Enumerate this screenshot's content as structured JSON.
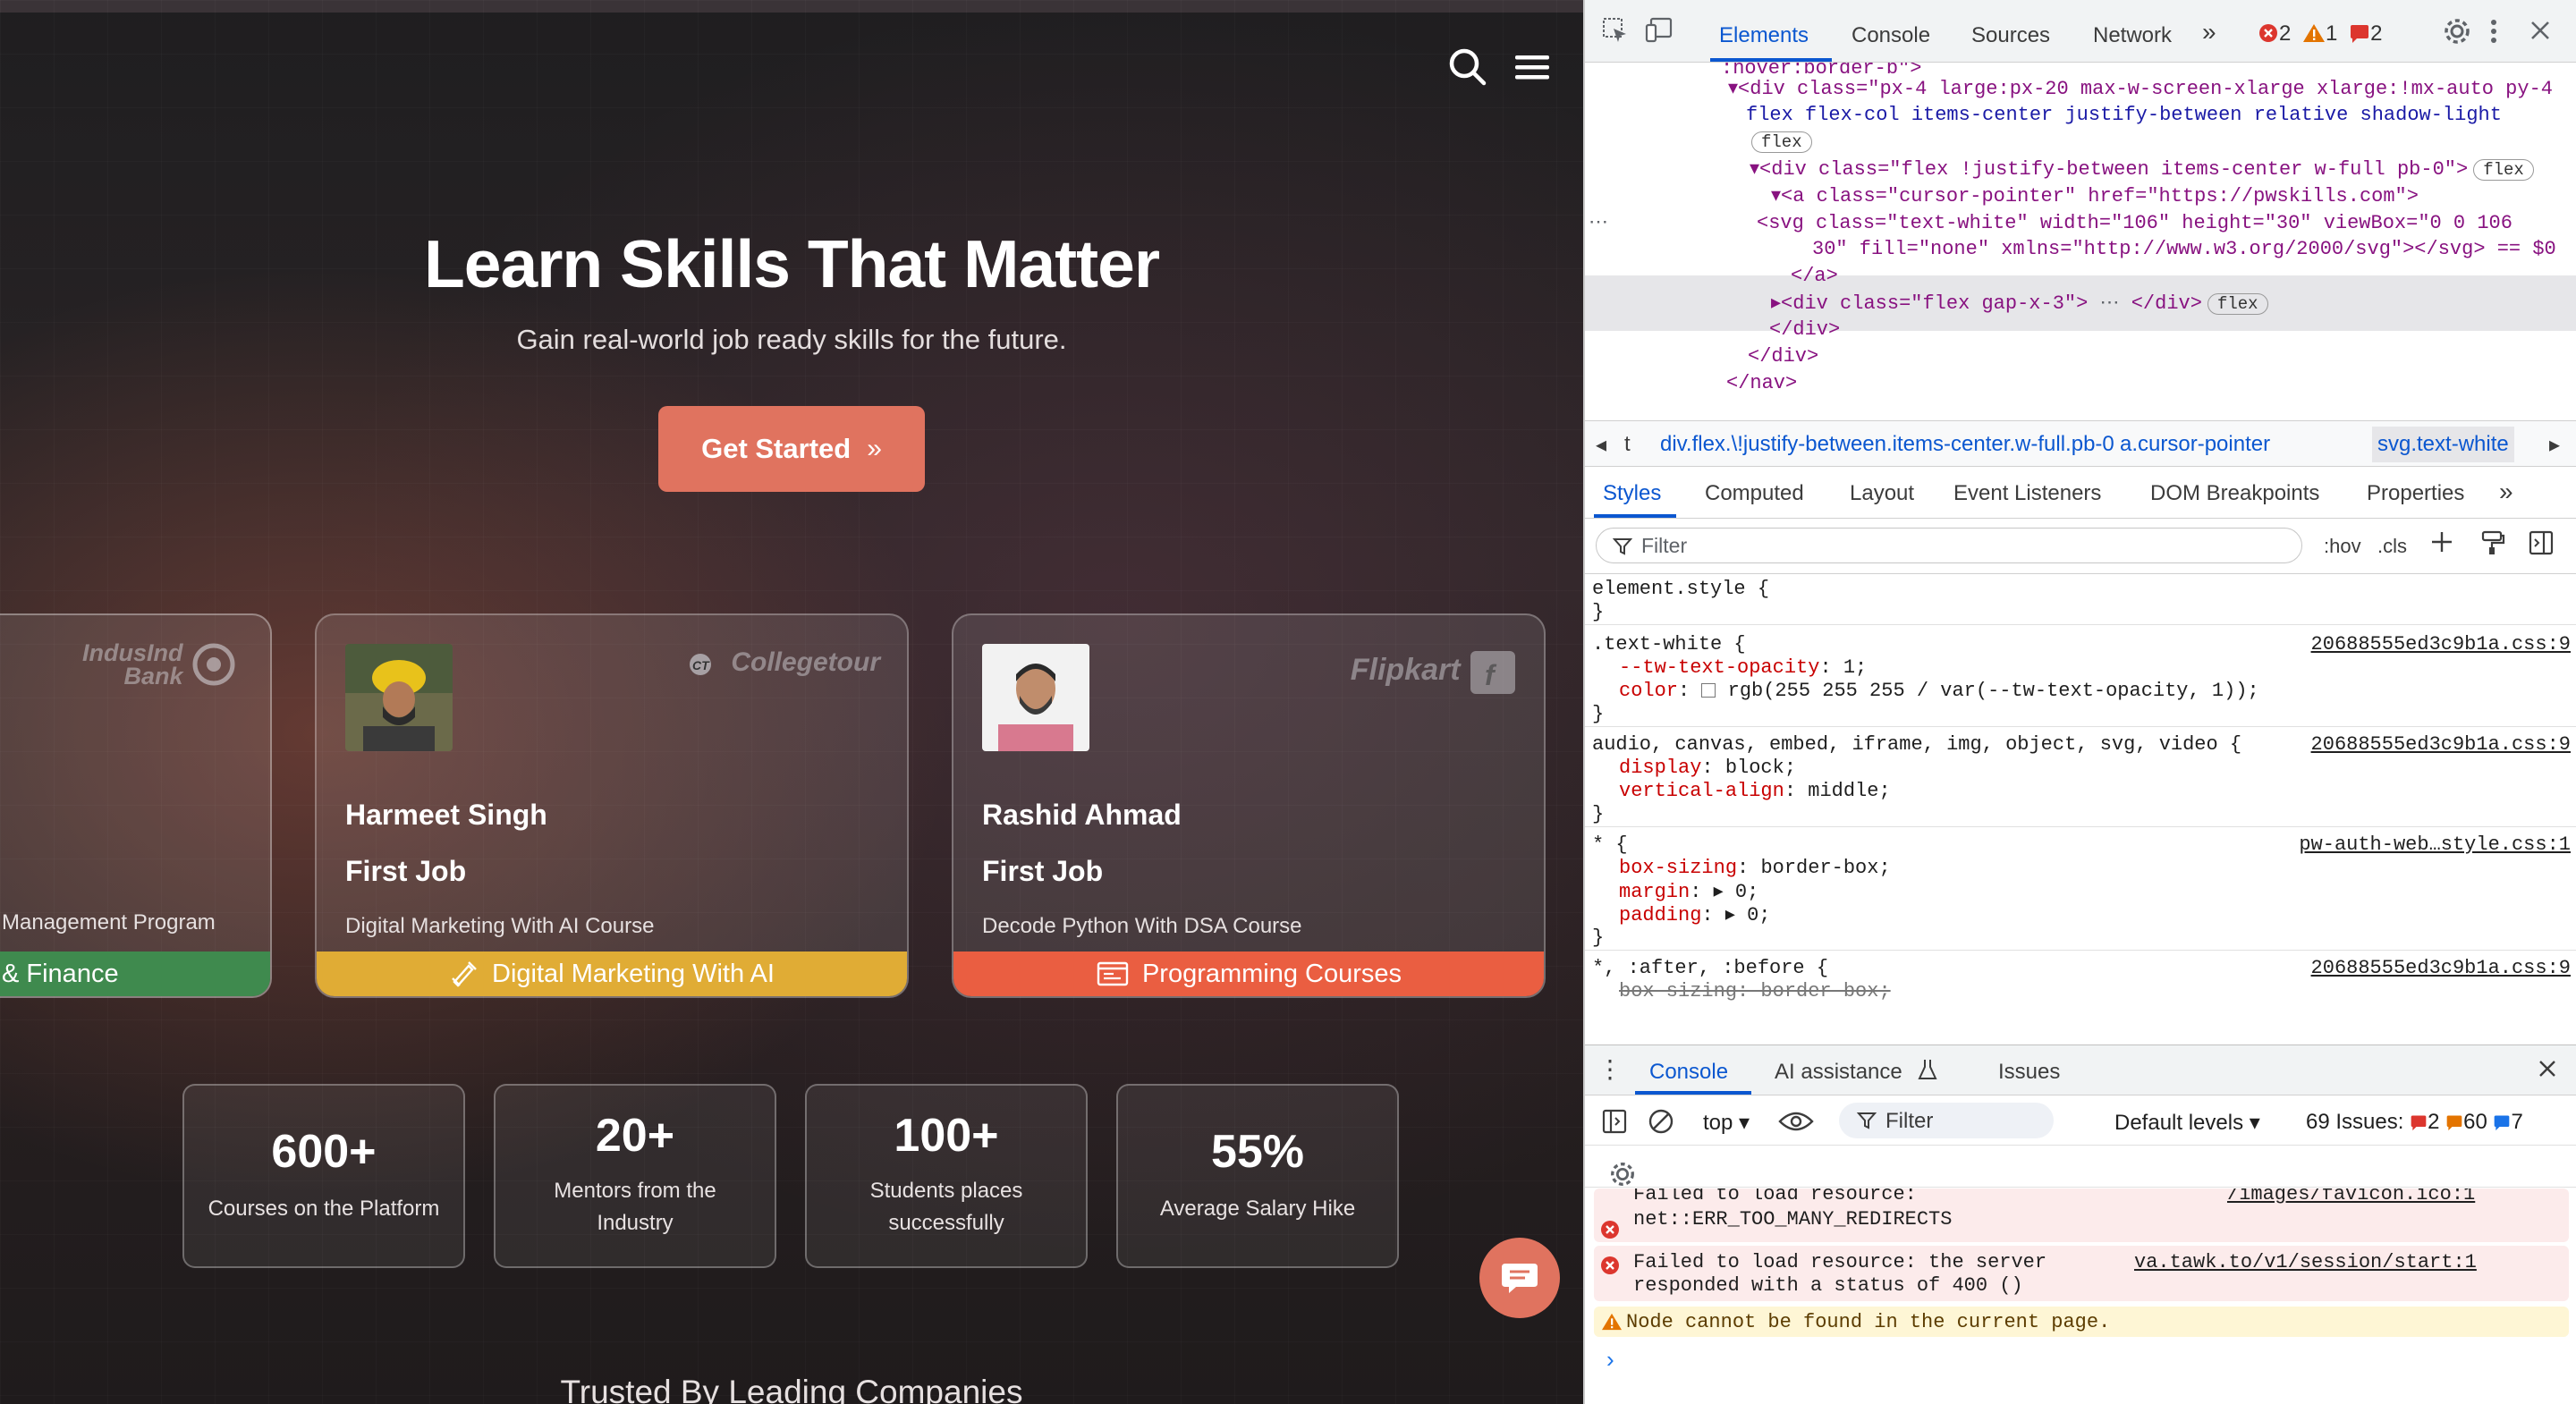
{
  "hero": {
    "title": "Learn Skills That Matter",
    "subtitle": "Gain real-world job ready skills for the future.",
    "cta_label": "Get Started",
    "cta_arrow": "»"
  },
  "cards": [
    {
      "logo": "IndusInd Bank",
      "course": "Management Program",
      "band": "& Finance",
      "band_color": "#3f8a4e"
    },
    {
      "name": "Harmeet Singh",
      "job": "First Job",
      "course": "Digital Marketing With AI Course",
      "band": "Digital Marketing With AI",
      "band_color": "#e0ac35",
      "logo": "Collegetour"
    },
    {
      "name": "Rashid Ahmad",
      "job": "First Job",
      "course": "Decode Python With DSA Course",
      "band": "Programming Courses",
      "band_color": "#ea5e41",
      "logo": "Flipkart"
    }
  ],
  "stats": [
    {
      "num": "600+",
      "label": "Courses on the Platform"
    },
    {
      "num": "20+",
      "label": "Mentors from the Industry"
    },
    {
      "num": "100+",
      "label": "Students places successfully"
    },
    {
      "num": "55%",
      "label": "Average Salary Hike"
    }
  ],
  "trusted": "Trusted By Leading Companies",
  "devtools": {
    "tabs": [
      "Elements",
      "Console",
      "Sources",
      "Network"
    ],
    "more": "»",
    "errors": "2",
    "warnings": "1",
    "issues": "2",
    "dom_lines": [
      ":hover:border-b\">",
      "<div class=\"px-4 large:px-20 max-w-screen-xlarge xlarge:!mx-auto py-4",
      "flex flex-col items-center justify-between relative shadow-light",
      "flex",
      "<div class=\"flex !justify-between items-center w-full pb-0\">",
      "<a class=\"cursor-pointer\" href=\"https://pwskills.com\">",
      "<svg class=\"text-white\" width=\"106\" height=\"30\" viewBox=\"0 0 106",
      "30\" fill=\"none\" xmlns=\"http://www.w3.org/2000/svg\"></svg> == $0",
      "</a>",
      "<div class=\"flex gap-x-3\">",
      "</div>",
      "</div>",
      "</nav>"
    ],
    "breadcrumbs": [
      "t",
      "div.flex.\\!justify-between.items-center.w-full.pb-0",
      "a.cursor-pointer",
      "svg.text-white"
    ],
    "subtabs": [
      "Styles",
      "Computed",
      "Layout",
      "Event Listeners",
      "DOM Breakpoints",
      "Properties"
    ],
    "filter_placeholder": "Filter",
    "hov": ":hov",
    "cls": ".cls",
    "styles": {
      "element_style": "element.style {",
      "close": "}",
      "text_white_sel": ".text-white {",
      "tw_prop": "--tw-text-opacity",
      "tw_val": "1;",
      "color_prop": "color",
      "color_val": "rgb(255 255 255 / var(--tw-text-opacity, 1));",
      "media_sel": "audio, canvas, embed, iframe, img, object, svg, video {",
      "display_prop": "display",
      "display_val": "block;",
      "va_prop": "vertical-align",
      "va_val": "middle;",
      "star_sel": "* {",
      "bs_prop": "box-sizing",
      "bs_val": "border-box;",
      "margin_prop": "margin",
      "margin_val": "0;",
      "padding_prop": "padding",
      "padding_val": "0;",
      "after_sel": "*, :after, :before {",
      "bs2": "box-sizing: border-box;",
      "src1": "20688555ed3c9b1a.css:9",
      "src2": "pw-auth-web…style.css:1"
    },
    "drawer_tabs": [
      "Console",
      "AI assistance",
      "Issues"
    ],
    "console": {
      "context": "top",
      "filter": "Filter",
      "levels": "Default levels",
      "issues_label": "69 Issues:",
      "issues_err": "2",
      "issues_warn": "60",
      "issues_info": "7",
      "msg1a": "Failed to load resource:",
      "msg1b": "net::ERR_TOO_MANY_REDIRECTS",
      "msg1src": "/images/favicon.ico:1",
      "msg2a": "Failed to load resource: the server",
      "msg2b": "responded with a status of 400 ()",
      "msg2src": "va.tawk.to/v1/session/start:1",
      "msg3": "Node cannot be found in the current page.",
      "prompt": "›"
    }
  }
}
